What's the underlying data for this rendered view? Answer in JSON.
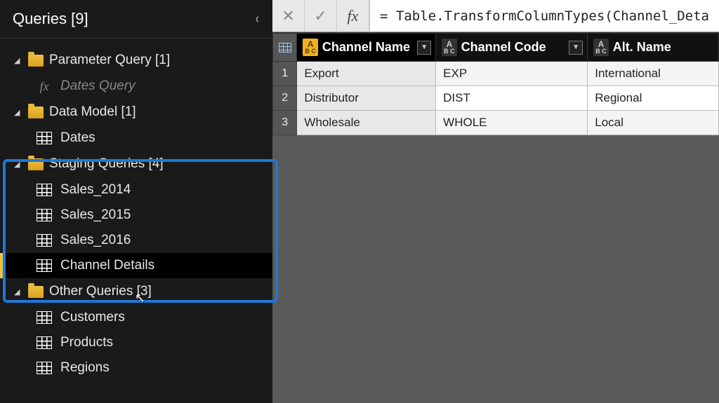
{
  "sidebar": {
    "title": "Queries [9]",
    "folders": [
      {
        "label": "Parameter Query [1]",
        "items": [
          {
            "label": "Dates Query",
            "type": "fx"
          }
        ]
      },
      {
        "label": "Data Model [1]",
        "items": [
          {
            "label": "Dates",
            "type": "table"
          }
        ]
      },
      {
        "label": "Staging Queries [4]",
        "items": [
          {
            "label": "Sales_2014",
            "type": "table"
          },
          {
            "label": "Sales_2015",
            "type": "table"
          },
          {
            "label": "Sales_2016",
            "type": "table"
          },
          {
            "label": "Channel Details",
            "type": "table",
            "selected": true
          }
        ]
      },
      {
        "label": "Other Queries [3]",
        "items": [
          {
            "label": "Customers",
            "type": "table"
          },
          {
            "label": "Products",
            "type": "table"
          },
          {
            "label": "Regions",
            "type": "table"
          }
        ]
      }
    ]
  },
  "formula": "= Table.TransformColumnTypes(Channel_Deta",
  "columns": [
    {
      "name": "Channel Name",
      "selected": true
    },
    {
      "name": "Channel Code",
      "selected": false
    },
    {
      "name": "Alt. Name",
      "selected": false
    }
  ],
  "rows": [
    {
      "c0": "Export",
      "c1": "EXP",
      "c2": "International"
    },
    {
      "c0": "Distributor",
      "c1": "DIST",
      "c2": "Regional"
    },
    {
      "c0": "Wholesale",
      "c1": "WHOLE",
      "c2": "Local"
    }
  ],
  "type_badge": {
    "top": "A",
    "sub": "B C"
  }
}
